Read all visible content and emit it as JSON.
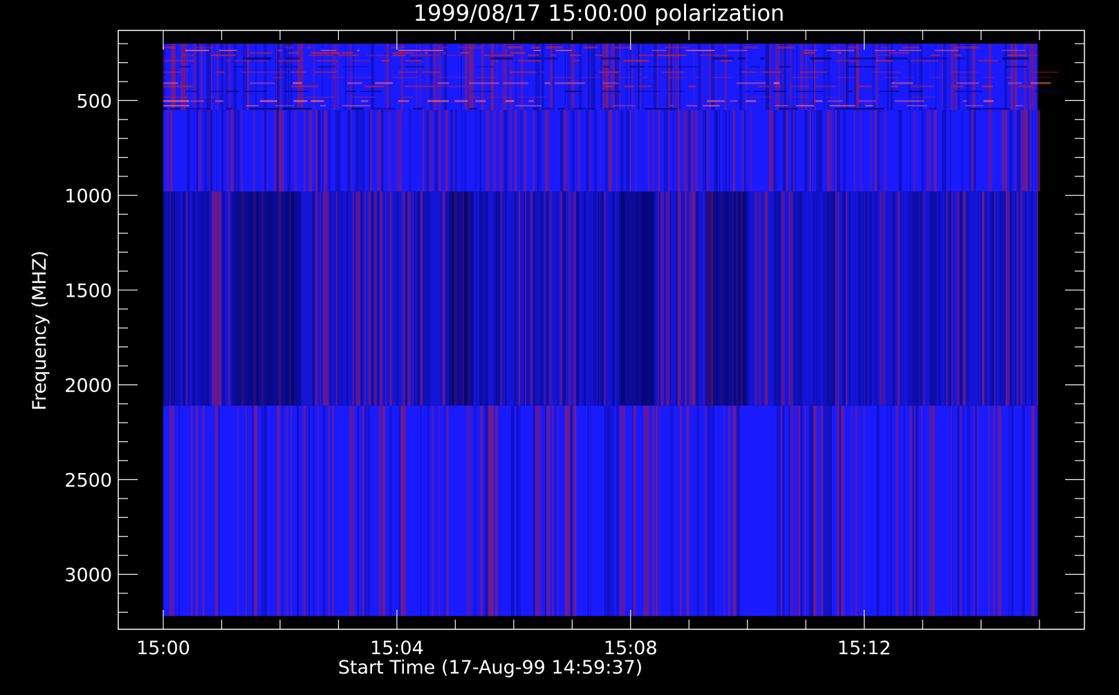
{
  "chart_data": {
    "type": "heatmap",
    "title": "1999/08/17 15:00:00 polarization",
    "xlabel": "Start Time (17-Aug-99 14:59:37)",
    "ylabel": "Frequency (MHZ)",
    "x_tick_labels": [
      "15:00",
      "15:04",
      "15:08",
      "15:12"
    ],
    "x_ticks_minutes": [
      0,
      4,
      8,
      12
    ],
    "x_range_minutes": [
      -0.77,
      15.77
    ],
    "x_data_range_minutes": [
      0,
      14.97
    ],
    "y_tick_labels": [
      "500",
      "1000",
      "1500",
      "2000",
      "2500",
      "3000"
    ],
    "y_ticks": [
      500,
      1000,
      1500,
      2000,
      2500,
      3000
    ],
    "y_range": [
      3290,
      130
    ],
    "y_data_range": [
      3220,
      200
    ],
    "y_axis_inverted": true,
    "frequency_bands": [
      {
        "from": 200,
        "to": 550,
        "appearance": "bright blue with red horizontal streaks"
      },
      {
        "from": 550,
        "to": 980,
        "appearance": "blue with red vertical stripes"
      },
      {
        "from": 980,
        "to": 2110,
        "appearance": "darker blue with dark vertical bands"
      },
      {
        "from": 2110,
        "to": 3220,
        "appearance": "blue with red vertical stripes"
      }
    ],
    "colors": {
      "background": "#000000",
      "axes": "#ffffff",
      "base": "#1a1aff",
      "dark": "#0a0a8c",
      "red": "#8a1a6a"
    },
    "grid": false
  }
}
